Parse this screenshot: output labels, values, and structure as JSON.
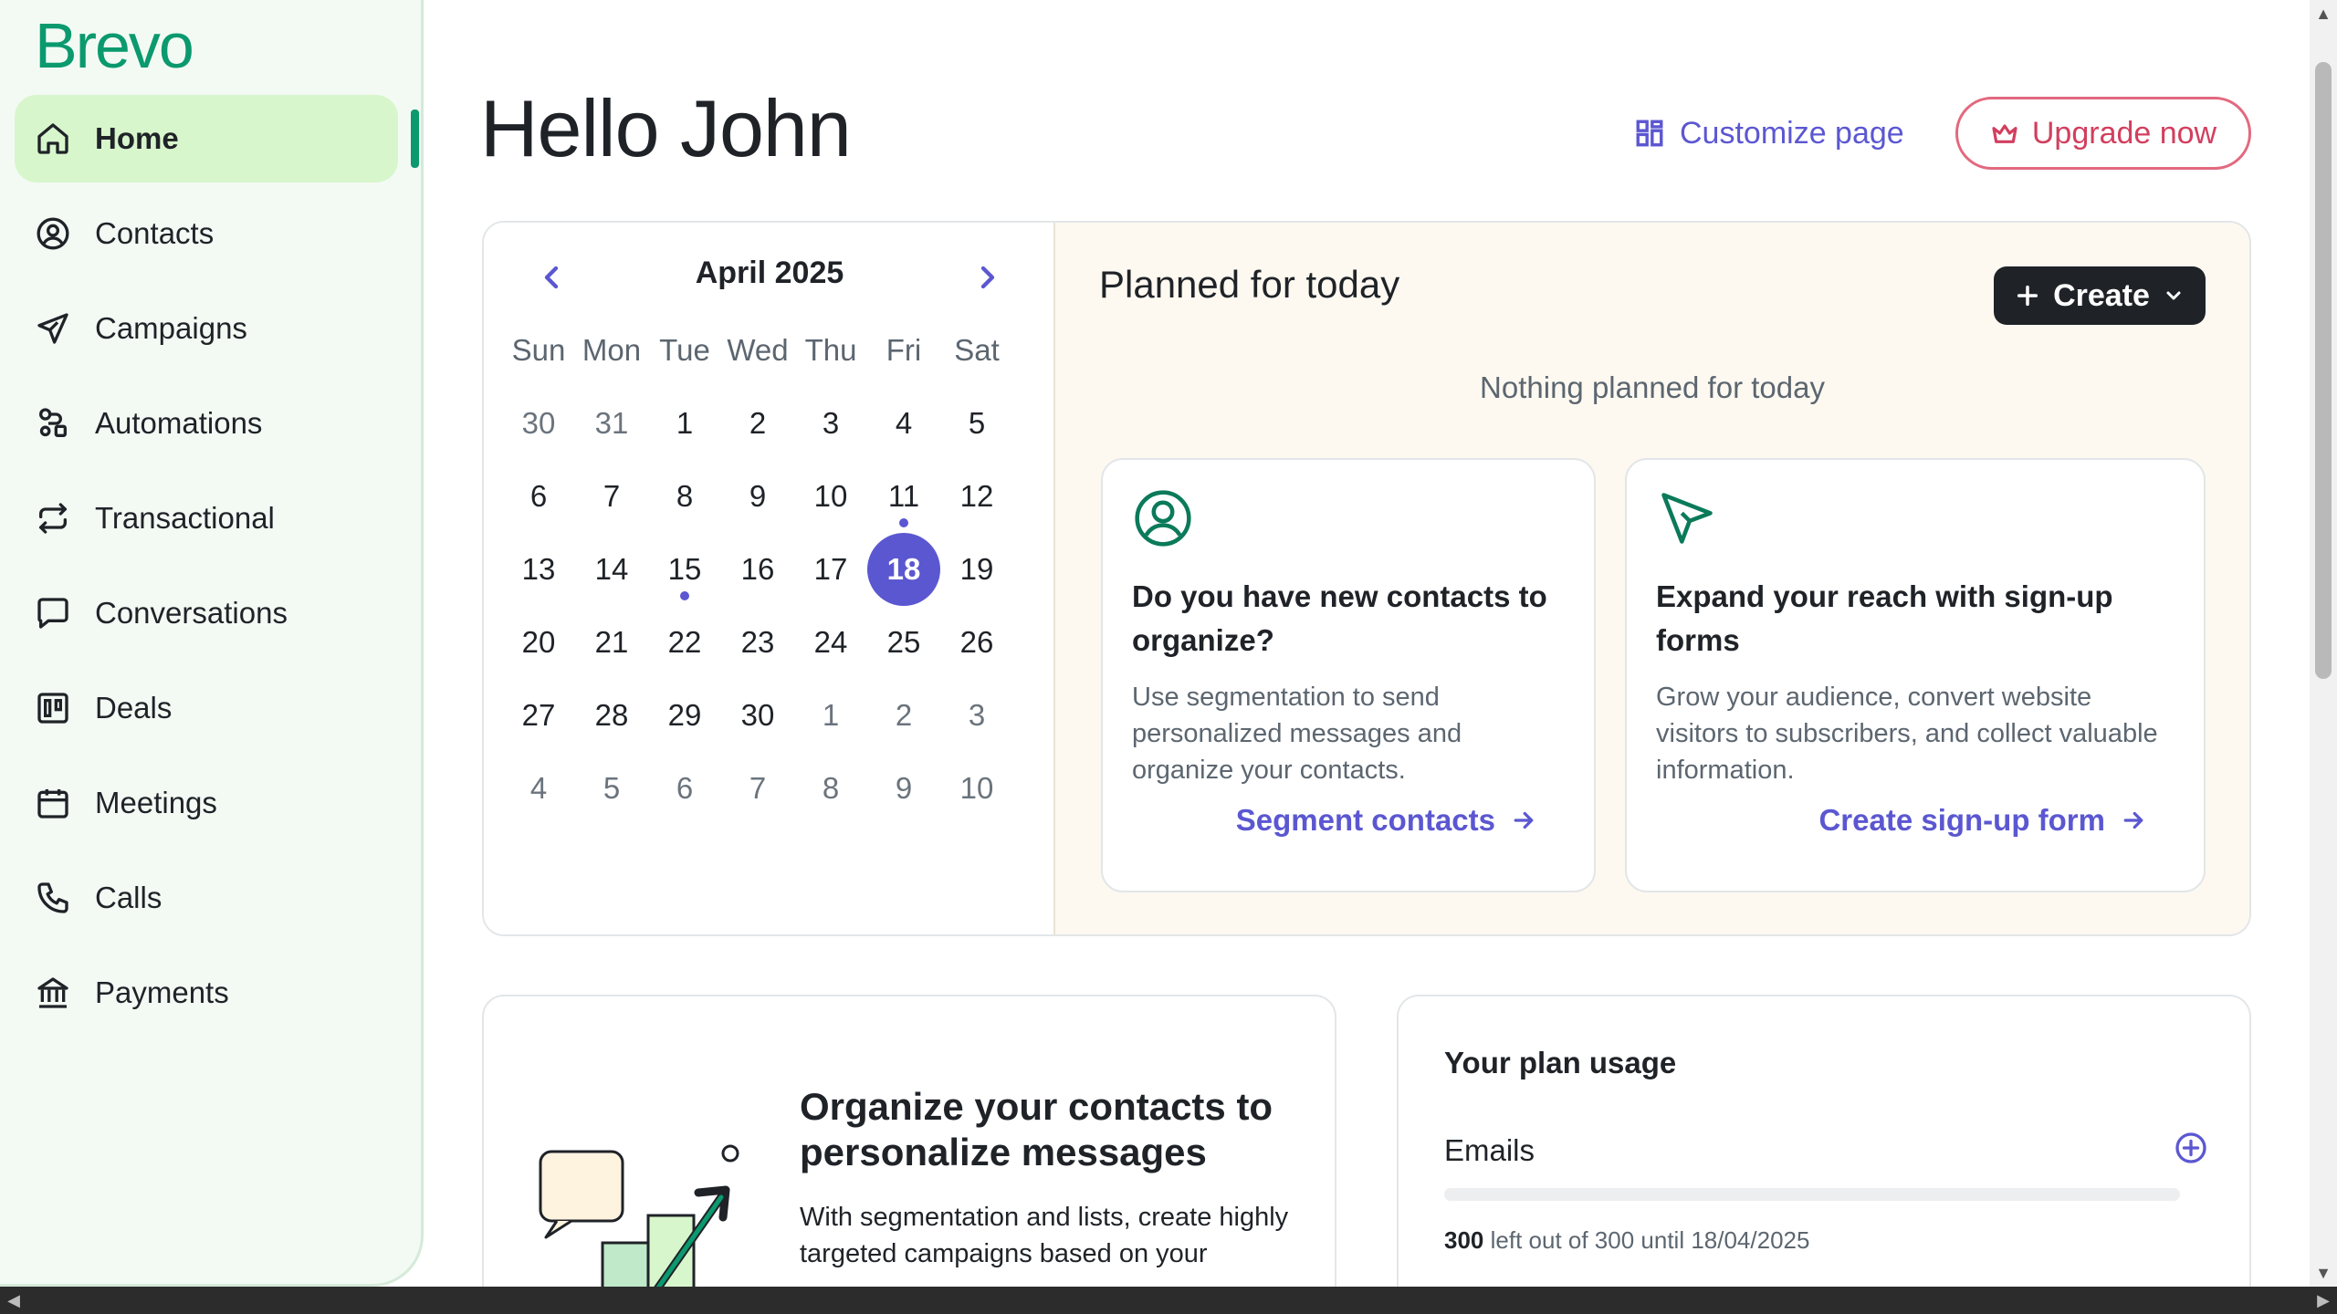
{
  "app": {
    "logo_text": "Brevo",
    "accent_color": "#0b996e",
    "brand_purple": "#5b57d1"
  },
  "sidebar": {
    "items": [
      {
        "label": "Home",
        "icon": "home-icon",
        "active": true
      },
      {
        "label": "Contacts",
        "icon": "contacts-icon"
      },
      {
        "label": "Campaigns",
        "icon": "paper-plane-icon"
      },
      {
        "label": "Automations",
        "icon": "automations-icon"
      },
      {
        "label": "Transactional",
        "icon": "transactional-icon"
      },
      {
        "label": "Conversations",
        "icon": "chat-icon"
      },
      {
        "label": "Deals",
        "icon": "deals-icon"
      },
      {
        "label": "Meetings",
        "icon": "calendar-icon"
      },
      {
        "label": "Calls",
        "icon": "phone-icon"
      },
      {
        "label": "Payments",
        "icon": "bank-icon"
      }
    ]
  },
  "header": {
    "greeting": "Hello John",
    "customize_label": "Customize page",
    "upgrade_label": "Upgrade now"
  },
  "calendar": {
    "month_label": "April 2025",
    "weekdays": [
      "Sun",
      "Mon",
      "Tue",
      "Wed",
      "Thu",
      "Fri",
      "Sat"
    ],
    "weeks": [
      [
        {
          "d": "30",
          "m": true
        },
        {
          "d": "31",
          "m": true
        },
        {
          "d": "1"
        },
        {
          "d": "2"
        },
        {
          "d": "3"
        },
        {
          "d": "4"
        },
        {
          "d": "5"
        }
      ],
      [
        {
          "d": "6"
        },
        {
          "d": "7"
        },
        {
          "d": "8"
        },
        {
          "d": "9"
        },
        {
          "d": "10"
        },
        {
          "d": "11",
          "dot": true
        },
        {
          "d": "12"
        }
      ],
      [
        {
          "d": "13"
        },
        {
          "d": "14"
        },
        {
          "d": "15",
          "dot": true
        },
        {
          "d": "16"
        },
        {
          "d": "17"
        },
        {
          "d": "18",
          "today": true
        },
        {
          "d": "19"
        }
      ],
      [
        {
          "d": "20"
        },
        {
          "d": "21"
        },
        {
          "d": "22"
        },
        {
          "d": "23"
        },
        {
          "d": "24"
        },
        {
          "d": "25"
        },
        {
          "d": "26"
        }
      ],
      [
        {
          "d": "27"
        },
        {
          "d": "28"
        },
        {
          "d": "29"
        },
        {
          "d": "30"
        },
        {
          "d": "1",
          "m": true
        },
        {
          "d": "2",
          "m": true
        },
        {
          "d": "3",
          "m": true
        }
      ],
      [
        {
          "d": "4",
          "m": true
        },
        {
          "d": "5",
          "m": true
        },
        {
          "d": "6",
          "m": true
        },
        {
          "d": "7",
          "m": true
        },
        {
          "d": "8",
          "m": true
        },
        {
          "d": "9",
          "m": true
        },
        {
          "d": "10",
          "m": true
        }
      ]
    ]
  },
  "planned": {
    "title": "Planned for today",
    "create_label": "Create",
    "empty_text": "Nothing planned for today",
    "tips": [
      {
        "title": "Do you have new contacts to organize?",
        "text": "Use segmentation to send personalized messages and organize your contacts.",
        "link": "Segment contacts"
      },
      {
        "title": "Expand your reach with sign-up forms",
        "text": "Grow your audience, convert website visitors to subscribers, and collect valuable information.",
        "link": "Create sign-up form"
      }
    ]
  },
  "organize": {
    "title": "Organize your contacts to personalize messages",
    "text": "With segmentation and lists, create highly targeted campaigns based on your"
  },
  "plan_usage": {
    "title": "Your plan usage",
    "emails_label": "Emails",
    "remaining": "300",
    "usage_suffix": "left out of 300 until 18/04/2025",
    "used_fraction": 0
  }
}
